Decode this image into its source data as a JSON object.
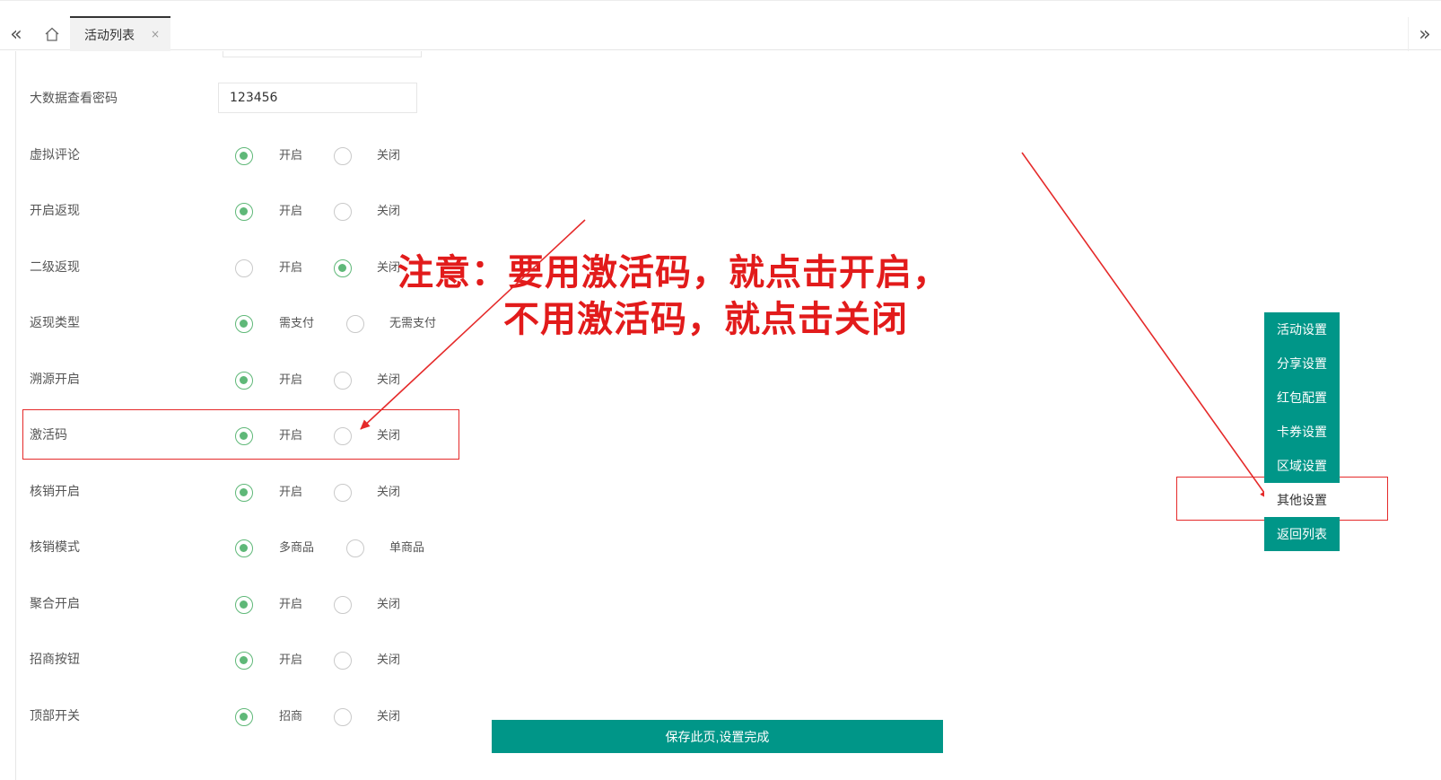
{
  "tabs": {
    "active_tab_label": "活动列表",
    "close_glyph": "×",
    "left_nav_glyph": "«",
    "right_nav_glyph": "»"
  },
  "form": {
    "rows": [
      {
        "label": "大数据查看密码",
        "type": "input",
        "value": "123456"
      },
      {
        "label": "虚拟评论",
        "type": "radio",
        "options": [
          "开启",
          "关闭"
        ],
        "selected": 0
      },
      {
        "label": "开启返现",
        "type": "radio",
        "options": [
          "开启",
          "关闭"
        ],
        "selected": 0
      },
      {
        "label": "二级返现",
        "type": "radio",
        "options": [
          "开启",
          "关闭"
        ],
        "selected": 1
      },
      {
        "label": "返现类型",
        "type": "radio",
        "options": [
          "需支付",
          "无需支付"
        ],
        "selected": 0
      },
      {
        "label": "溯源开启",
        "type": "radio",
        "options": [
          "开启",
          "关闭"
        ],
        "selected": 0
      },
      {
        "label": "激活码",
        "type": "radio",
        "options": [
          "开启",
          "关闭"
        ],
        "selected": 0
      },
      {
        "label": "核销开启",
        "type": "radio",
        "options": [
          "开启",
          "关闭"
        ],
        "selected": 0
      },
      {
        "label": "核销模式",
        "type": "radio",
        "options": [
          "多商品",
          "单商品"
        ],
        "selected": 0
      },
      {
        "label": "聚合开启",
        "type": "radio",
        "options": [
          "开启",
          "关闭"
        ],
        "selected": 0
      },
      {
        "label": "招商按钮",
        "type": "radio",
        "options": [
          "开启",
          "关闭"
        ],
        "selected": 0
      },
      {
        "label": "顶部开关",
        "type": "radio",
        "options": [
          "招商",
          "关闭"
        ],
        "selected": 0
      }
    ]
  },
  "annotation": {
    "line1": "注意：要用激活码，就点击开启，",
    "line2": "不用激活码，就点击关闭",
    "color": "#e21b1b"
  },
  "side_menu": {
    "items": [
      "活动设置",
      "分享设置",
      "红包配置",
      "卡券设置",
      "区域设置",
      "其他设置",
      "返回列表"
    ],
    "active_index": 5
  },
  "save_button": {
    "label": "保存此页,设置完成"
  },
  "colors": {
    "accent": "#009688",
    "radio_on": "#5fb878",
    "highlight": "#e52a2a"
  }
}
